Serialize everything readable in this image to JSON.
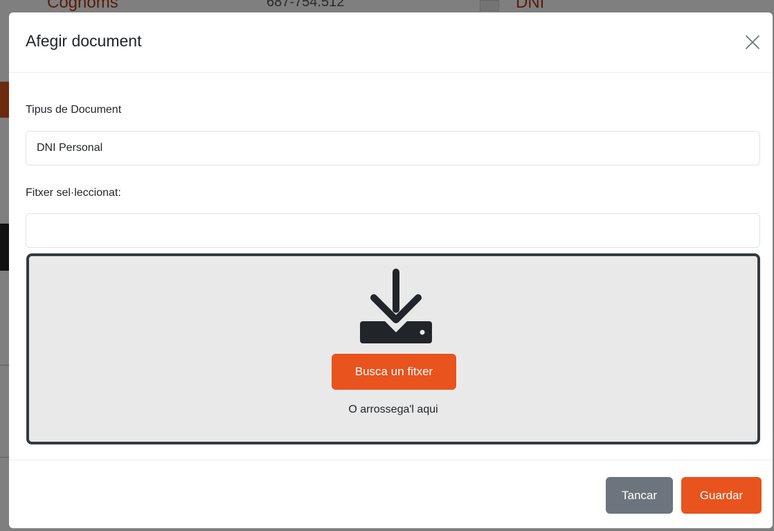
{
  "background": {
    "top_left_text": "Cognoms",
    "top_middle_text": "687-754.512",
    "top_right_text": "DNI"
  },
  "modal": {
    "title": "Afegir document",
    "close_icon": "close-icon",
    "fields": {
      "document_type": {
        "label": "Tipus de Document",
        "value": "DNI Personal"
      },
      "selected_file": {
        "label": "Fitxer sel·leccionat:",
        "value": ""
      }
    },
    "dropzone": {
      "icon": "download-icon",
      "browse_label": "Busca un fitxer",
      "hint": "O arrossega'l aqui"
    },
    "footer": {
      "close_label": "Tancar",
      "save_label": "Guardar"
    }
  },
  "colors": {
    "accent": "#e8531e",
    "secondary": "#6c757d",
    "dropzone_border": "#333a41",
    "dropzone_bg": "#e9e9e9"
  }
}
